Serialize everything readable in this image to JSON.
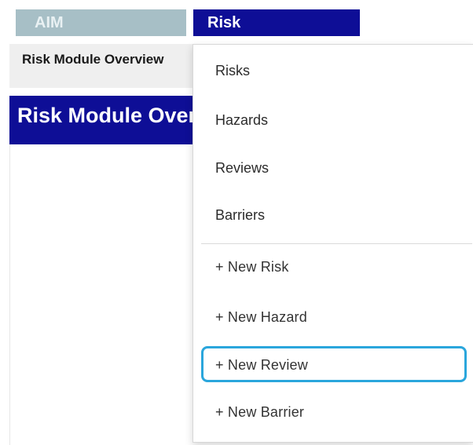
{
  "nav": {
    "tabs": [
      {
        "label": "AIM"
      },
      {
        "label": "Risk"
      }
    ]
  },
  "page": {
    "breadcrumb": "Risk Module Overview",
    "title": "Risk Module Overview"
  },
  "dropdown": {
    "items": [
      {
        "label": "Risks"
      },
      {
        "label": "Hazards"
      },
      {
        "label": "Reviews"
      },
      {
        "label": "Barriers"
      }
    ],
    "actions": [
      {
        "label": "+ New Risk"
      },
      {
        "label": "+ New Hazard"
      },
      {
        "label": "+ New Review"
      },
      {
        "label": "+ New Barrier"
      }
    ],
    "highlighted_action": "+ New Review"
  },
  "colors": {
    "risk_tab": "#0e0e96",
    "aim_tab": "#a7bfc6",
    "highlight": "#2aa6dc"
  }
}
